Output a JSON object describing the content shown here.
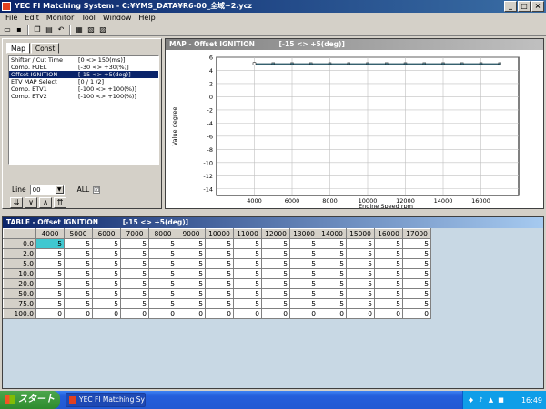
{
  "window": {
    "title": "YEC FI Matching System - C:¥YMS_DATA¥R6-00_全域~2.ycz",
    "min_label": "_",
    "max_label": "□",
    "close_label": "×"
  },
  "menu": [
    "File",
    "Edit",
    "Monitor",
    "Tool",
    "Window",
    "Help"
  ],
  "toolbar": [
    "open-icon",
    "save-icon",
    "copy-icon",
    "paste-icon",
    "undo-icon",
    "grid-icon",
    "map-icon",
    "chart-icon"
  ],
  "left_panel": {
    "tabs": [
      "Map",
      "Const"
    ],
    "list": [
      {
        "name": "Shifter / Cut Time",
        "range": "[0 <> 150(ms)]"
      },
      {
        "name": "Comp. FUEL",
        "range": "[-30 <> +30(%)]"
      },
      {
        "name": "Offset IGNITION",
        "range": "[-15 <> +5(deg)]"
      },
      {
        "name": "ETV MAP Select",
        "range": "[0 / 1 /2]"
      },
      {
        "name": "Comp. ETV1",
        "range": "[-100 <> +100(%)]"
      },
      {
        "name": "Comp. ETV2",
        "range": "[-100 <> +100(%)]"
      }
    ],
    "selected_index": 2,
    "line_label": "Line",
    "line_value": "00",
    "all_label": "ALL",
    "all_checked": "☑"
  },
  "map_panel": {
    "title": "MAP - Offset IGNITION",
    "range": "[-15 <> +5(deg)]"
  },
  "chart_data": {
    "type": "line",
    "x": [
      4000,
      5000,
      6000,
      7000,
      8000,
      9000,
      10000,
      11000,
      12000,
      13000,
      14000,
      15000,
      16000,
      17000
    ],
    "series": [
      {
        "values": [
          5,
          5,
          5,
          5,
          5,
          5,
          5,
          5,
          5,
          5,
          5,
          5,
          5,
          5
        ]
      }
    ],
    "xlabel": "Engine Speed rpm",
    "ylabel": "Value degree",
    "xlim": [
      2000,
      18000
    ],
    "ylim": [
      -15,
      6
    ],
    "xticks": [
      4000,
      6000,
      8000,
      10000,
      12000,
      14000,
      16000
    ],
    "yticks": [
      6,
      4,
      2,
      0,
      -2,
      -4,
      -6,
      -8,
      -10,
      -12,
      -14
    ],
    "grid": true
  },
  "table_panel": {
    "title": "TABLE - Offset IGNITION",
    "range": "[-15 <> +5(deg)]",
    "columns": [
      "4000",
      "5000",
      "6000",
      "7000",
      "8000",
      "9000",
      "10000",
      "11000",
      "12000",
      "13000",
      "14000",
      "15000",
      "16000",
      "17000"
    ],
    "rows": [
      {
        "label": "0.0",
        "values": [
          "5",
          "5",
          "5",
          "5",
          "5",
          "5",
          "5",
          "5",
          "5",
          "5",
          "5",
          "5",
          "5",
          "5"
        ]
      },
      {
        "label": "2.0",
        "values": [
          "5",
          "5",
          "5",
          "5",
          "5",
          "5",
          "5",
          "5",
          "5",
          "5",
          "5",
          "5",
          "5",
          "5"
        ]
      },
      {
        "label": "5.0",
        "values": [
          "5",
          "5",
          "5",
          "5",
          "5",
          "5",
          "5",
          "5",
          "5",
          "5",
          "5",
          "5",
          "5",
          "5"
        ]
      },
      {
        "label": "10.0",
        "values": [
          "5",
          "5",
          "5",
          "5",
          "5",
          "5",
          "5",
          "5",
          "5",
          "5",
          "5",
          "5",
          "5",
          "5"
        ]
      },
      {
        "label": "20.0",
        "values": [
          "5",
          "5",
          "5",
          "5",
          "5",
          "5",
          "5",
          "5",
          "5",
          "5",
          "5",
          "5",
          "5",
          "5"
        ]
      },
      {
        "label": "50.0",
        "values": [
          "5",
          "5",
          "5",
          "5",
          "5",
          "5",
          "5",
          "5",
          "5",
          "5",
          "5",
          "5",
          "5",
          "5"
        ]
      },
      {
        "label": "75.0",
        "values": [
          "5",
          "5",
          "5",
          "5",
          "5",
          "5",
          "5",
          "5",
          "5",
          "5",
          "5",
          "5",
          "5",
          "5"
        ]
      },
      {
        "label": "100.0",
        "values": [
          "0",
          "0",
          "0",
          "0",
          "0",
          "0",
          "0",
          "0",
          "0",
          "0",
          "0",
          "0",
          "0",
          "0"
        ]
      }
    ]
  },
  "taskbar": {
    "start_label": "スタート",
    "task_item": "YEC FI Matching Sys...",
    "clock": "16:49"
  },
  "colors": {
    "title_active": "#0a246a",
    "selected_cell": "#40c8d0",
    "series": "#1a4a5a"
  }
}
